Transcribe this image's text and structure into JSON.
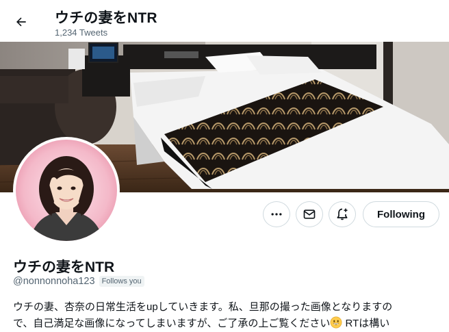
{
  "header": {
    "back_icon": "arrow-left-icon",
    "title": "ウチの妻をNTR",
    "tweet_count": "1,234 Tweets"
  },
  "profile": {
    "display_name": "ウチの妻をNTR",
    "handle": "@nonnonnoha123",
    "follows_you": "Follows you",
    "bio_line1": "ウチの妻、杏奈の日常生活をupしていきます。私、旦那の撮った画像となりますの",
    "bio_line2_a": "で、自己満足な画像になってしまいますが、ご了承の上ご覧ください",
    "bio_emoji": "grinning-face-emoji",
    "bio_line2_b": " RTは構い"
  },
  "actions": {
    "more_icon": "more-dots-icon",
    "message_icon": "envelope-icon",
    "notify_icon": "bell-plus-icon",
    "follow_label": "Following"
  },
  "colors": {
    "text_primary": "#0f1419",
    "text_secondary": "#536471",
    "border": "#cfd9de",
    "badge_bg": "#eff3f4"
  }
}
